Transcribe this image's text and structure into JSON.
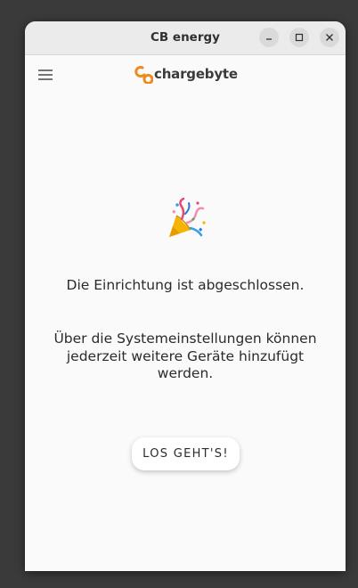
{
  "window": {
    "title": "CB energy",
    "controls": {
      "minimize": "minimize-icon",
      "maximize": "maximize-icon",
      "close": "close-icon"
    }
  },
  "appbar": {
    "menu_icon": "hamburger-menu-icon",
    "brand": "chargebyte",
    "brand_color": "#f08a1c"
  },
  "main": {
    "emoji_icon": "party-popper-icon",
    "setup_done": "Die Einrichtung ist abgeschlossen.",
    "settings_hint": "Über die Systemeinstellungen können jederzeit weitere Geräte hinzufügt werden.",
    "start_button": "LOS GEHT'S!"
  }
}
